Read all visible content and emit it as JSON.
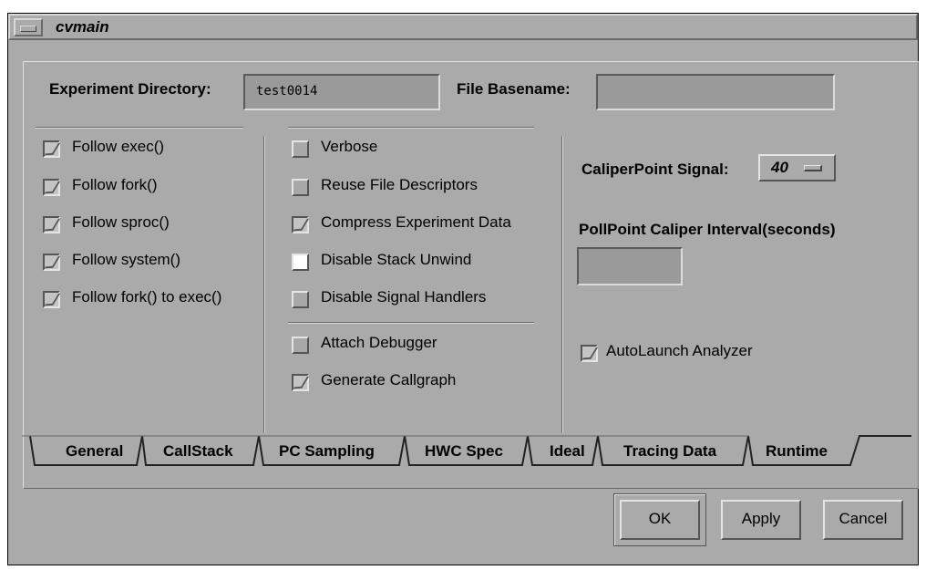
{
  "window": {
    "title": "cvmain"
  },
  "experiment": {
    "directory_label": "Experiment Directory:",
    "directory_value": "test0014",
    "basename_label": "File Basename:",
    "basename_value": ""
  },
  "follow_options": [
    {
      "label": "Follow exec()",
      "checked": true
    },
    {
      "label": "Follow fork()",
      "checked": true
    },
    {
      "label": "Follow sproc()",
      "checked": true
    },
    {
      "label": "Follow system()",
      "checked": true
    },
    {
      "label": "Follow fork() to exec()",
      "checked": true
    }
  ],
  "runtime_options": [
    {
      "label": "Verbose",
      "checked": false
    },
    {
      "label": "Reuse File Descriptors",
      "checked": false
    },
    {
      "label": "Compress Experiment Data",
      "checked": true
    },
    {
      "label": "Disable Stack Unwind",
      "checked": false,
      "highlighted": true
    },
    {
      "label": "Disable Signal Handlers",
      "checked": false
    }
  ],
  "debug_options": [
    {
      "label": "Attach Debugger",
      "checked": false
    },
    {
      "label": "Generate Callgraph",
      "checked": true
    }
  ],
  "caliper": {
    "signal_label": "CaliperPoint Signal:",
    "signal_value": "40",
    "interval_label": "PollPoint Caliper Interval(seconds)",
    "interval_value": ""
  },
  "autolaunch": {
    "label": "AutoLaunch Analyzer",
    "checked": true
  },
  "tabs": [
    {
      "label": "General",
      "active": false
    },
    {
      "label": "CallStack",
      "active": false
    },
    {
      "label": "PC Sampling",
      "active": false
    },
    {
      "label": "HWC Spec",
      "active": false
    },
    {
      "label": "Ideal",
      "active": false
    },
    {
      "label": "Tracing Data",
      "active": false
    },
    {
      "label": "Runtime",
      "active": true
    }
  ],
  "buttons": {
    "ok": "OK",
    "apply": "Apply",
    "cancel": "Cancel"
  }
}
